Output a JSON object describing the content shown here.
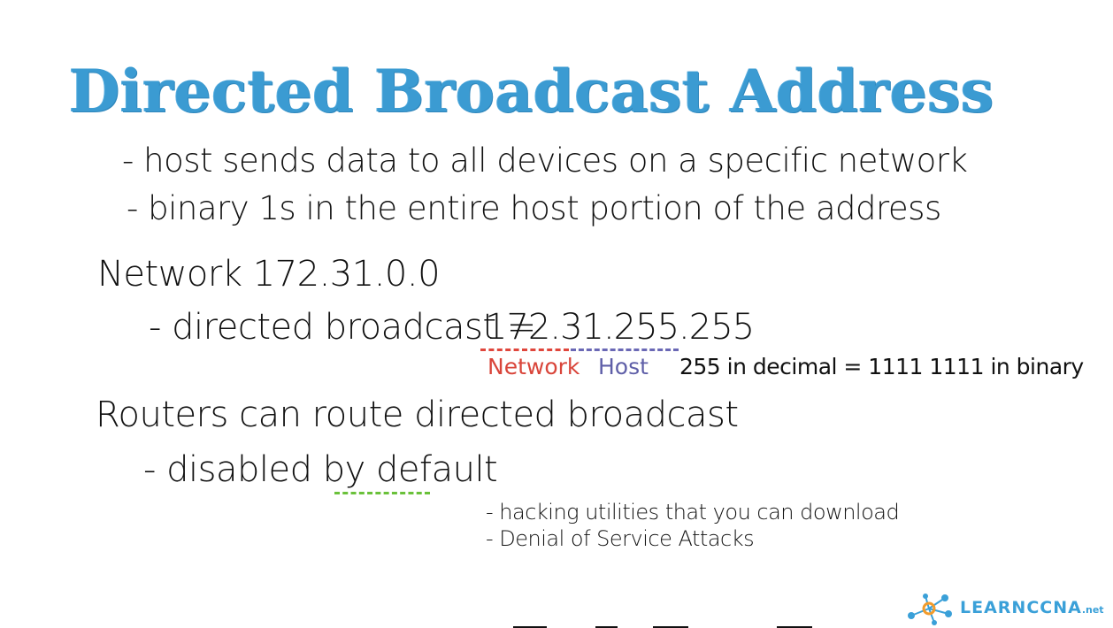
{
  "slide": {
    "title": "Directed Broadcast Address",
    "bullets": [
      "- host sends data to all devices on a specific network",
      "- binary 1s in the entire host portion of the address"
    ],
    "network_line": "Network 172.31.0.0",
    "directed_label": "- directed broadcast = ",
    "directed_address": "172.31.255.255",
    "label_network": "Network",
    "label_host": "Host",
    "note_255": "255 in decimal = 1111 1111 in binary",
    "routers_line": "Routers can route directed broadcast",
    "disabled_prefix": "- disabled by ",
    "disabled_word": "default",
    "sub_bullets": [
      "- hacking utilities that you can download",
      "- Denial of Service Attacks"
    ]
  },
  "logo": {
    "text": "LEARNCCNA",
    "suffix": ".net",
    "icon": "network-nodes-icon"
  },
  "colors": {
    "title": "#3b9bd2",
    "network_red": "#d9453a",
    "host_blue": "#5f5fa8",
    "default_green": "#6ac13a",
    "logo_blue": "#3aa0d8"
  }
}
